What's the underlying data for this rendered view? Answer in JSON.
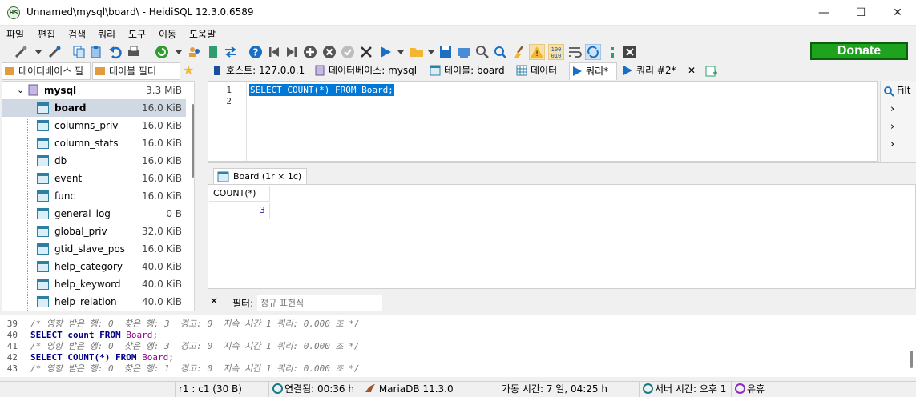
{
  "window": {
    "title": "Unnamed\\mysql\\board\\ - HeidiSQL 12.3.0.6589",
    "app_icon_text": "HS",
    "controls": {
      "minimize": "—",
      "maximize": "☐",
      "close": "✕"
    }
  },
  "menu": [
    "파일",
    "편집",
    "검색",
    "쿼리",
    "도구",
    "이동",
    "도움말"
  ],
  "toolbar": {
    "donate_label": "Donate",
    "icons": [
      "connect-icon",
      "dropdown-icon",
      "disconnect-icon",
      "copy-icon",
      "paste-icon",
      "undo-icon",
      "print-icon",
      "refresh-icon",
      "users-icon",
      "export-icon",
      "import-icon",
      "help-icon",
      "first-icon",
      "last-icon",
      "add-icon",
      "cancel-icon",
      "apply-icon",
      "delete-icon",
      "run-icon",
      "open-icon",
      "save-icon",
      "find-icon",
      "replace-icon",
      "clear-icon",
      "warning-icon",
      "binary-icon",
      "wrap-icon",
      "sync-icon",
      "explain-icon",
      "stop-icon"
    ]
  },
  "left_tabs": {
    "db_filter_placeholder": "데이터베이스 필",
    "table_filter_placeholder": "테이블 필터",
    "star": "★"
  },
  "main_tabs": [
    {
      "label": "호스트: 127.0.0.1",
      "icon": "host-icon"
    },
    {
      "label": "데이터베이스: mysql",
      "icon": "database-icon"
    },
    {
      "label": "테이블: board",
      "icon": "table-icon"
    },
    {
      "label": "데이터",
      "icon": "data-grid-icon"
    },
    {
      "label": "쿼리*",
      "icon": "query-play-icon"
    },
    {
      "label": "쿼리 #2*",
      "icon": "query-play-icon"
    }
  ],
  "close_tab": "✕",
  "tree": {
    "database": {
      "name": "mysql",
      "size": "3.3 MiB"
    },
    "tables": [
      {
        "name": "board",
        "size": "16.0 KiB"
      },
      {
        "name": "columns_priv",
        "size": "16.0 KiB"
      },
      {
        "name": "column_stats",
        "size": "16.0 KiB"
      },
      {
        "name": "db",
        "size": "16.0 KiB"
      },
      {
        "name": "event",
        "size": "16.0 KiB"
      },
      {
        "name": "func",
        "size": "16.0 KiB"
      },
      {
        "name": "general_log",
        "size": "0 B"
      },
      {
        "name": "global_priv",
        "size": "32.0 KiB"
      },
      {
        "name": "gtid_slave_pos",
        "size": "16.0 KiB"
      },
      {
        "name": "help_category",
        "size": "40.0 KiB"
      },
      {
        "name": "help_keyword",
        "size": "40.0 KiB"
      },
      {
        "name": "help_relation",
        "size": "40.0 KiB"
      }
    ]
  },
  "editor": {
    "line_numbers": [
      "1",
      "2"
    ],
    "sql": "SELECT COUNT(*) FROM Board;"
  },
  "filter_panel": {
    "label": "Filt",
    "chevrons": [
      "›",
      "›",
      "›"
    ]
  },
  "results": {
    "tab_label": "Board (1r × 1c)",
    "columns": [
      "COUNT(*)"
    ],
    "rows": [
      [
        "3"
      ]
    ]
  },
  "filterbar": {
    "close": "✕",
    "label": "필터:",
    "placeholder": "정규 표현식"
  },
  "log": [
    {
      "num": "39",
      "type": "comment",
      "text": "/* 영향 받은 행: 0  찾은 행: 3  경고: 0  지속 시간 1 쿼리: 0.000 초 */"
    },
    {
      "num": "40",
      "type": "sql",
      "kw1": "SELECT",
      "mid": "count",
      "kw2": "FROM",
      "table": "Board",
      "tail": ";"
    },
    {
      "num": "41",
      "type": "comment",
      "text": "/* 영향 받은 행: 0  찾은 행: 3  경고: 0  지속 시간 1 쿼리: 0.000 초 */"
    },
    {
      "num": "42",
      "type": "sql",
      "kw1": "SELECT",
      "mid": "COUNT(*)",
      "kw2": "FROM",
      "table": "Board",
      "tail": ";"
    },
    {
      "num": "43",
      "type": "comment",
      "text": "/* 영향 받은 행: 0  찾은 행: 1  경고: 0  지속 시간 1 쿼리: 0.000 초 */"
    }
  ],
  "status": {
    "cursor": "r1 : c1 (30 B)",
    "connected": "연결됨: 00:36 h",
    "server": "MariaDB 11.3.0",
    "uptime": "가동 시간: 7 일, 04:25 h",
    "server_time": "서버 시간: 오후 1",
    "idle": "유휴"
  }
}
